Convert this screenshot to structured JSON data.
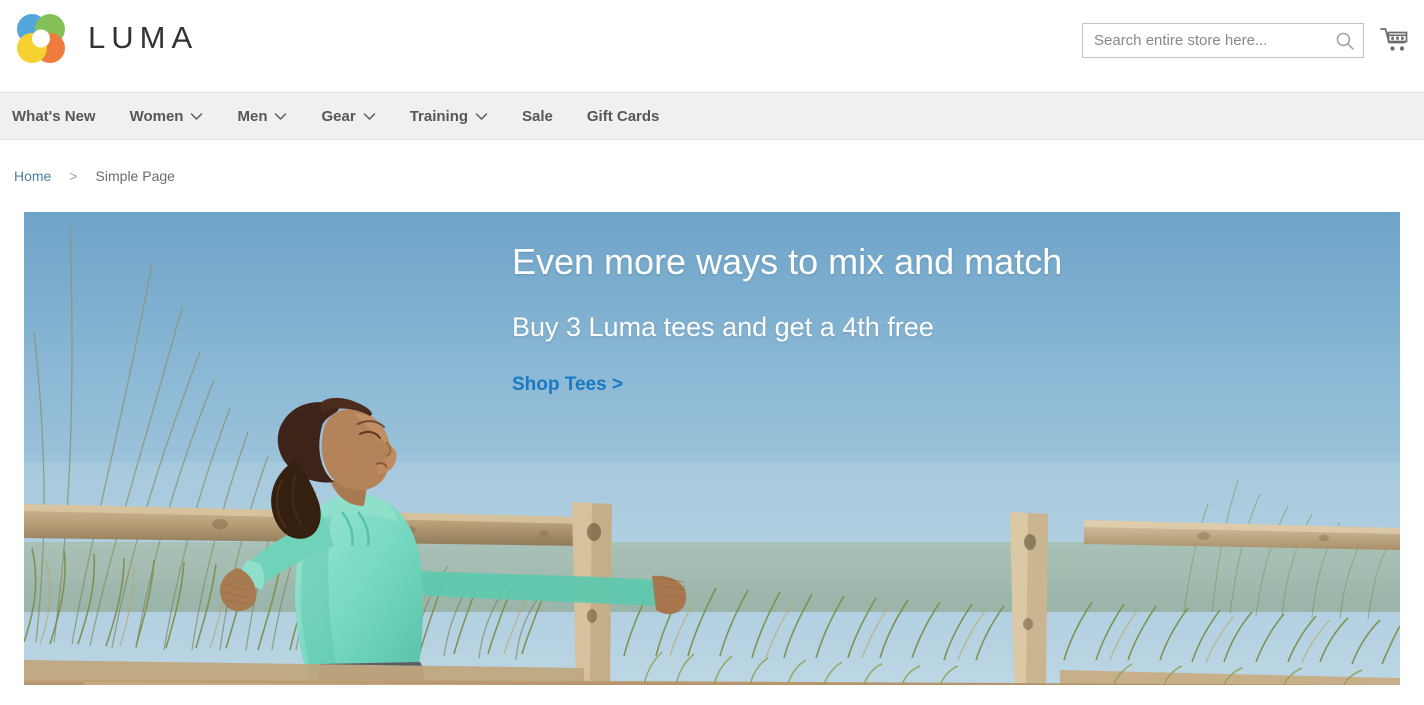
{
  "header": {
    "logo_text": "LUMA",
    "logo_icon": "luma-rings-logo",
    "logo_colors": [
      "#5ba3d9",
      "#7ab648",
      "#f5a623",
      "#f0c419",
      "#e8682c"
    ],
    "search": {
      "placeholder": "Search entire store here...",
      "value": "",
      "icon": "search-icon"
    },
    "cart": {
      "icon": "shopping-cart-icon",
      "count": ""
    }
  },
  "nav": {
    "items": [
      {
        "label": "What's New",
        "has_dropdown": false
      },
      {
        "label": "Women",
        "has_dropdown": true
      },
      {
        "label": "Men",
        "has_dropdown": true
      },
      {
        "label": "Gear",
        "has_dropdown": true
      },
      {
        "label": "Training",
        "has_dropdown": true
      },
      {
        "label": "Sale",
        "has_dropdown": false
      },
      {
        "label": "Gift Cards",
        "has_dropdown": false
      }
    ]
  },
  "breadcrumb": {
    "home": "Home",
    "separator": ">",
    "current": "Simple Page"
  },
  "banner": {
    "title": "Even more ways to mix and match",
    "subtitle": "Buy 3 Luma tees and get a 4th free",
    "cta": "Shop Tees >",
    "cta_color": "#1979c3",
    "image_description": "Woman in mint hoodie leaning on wooden fence among dune grass under blue sky"
  }
}
